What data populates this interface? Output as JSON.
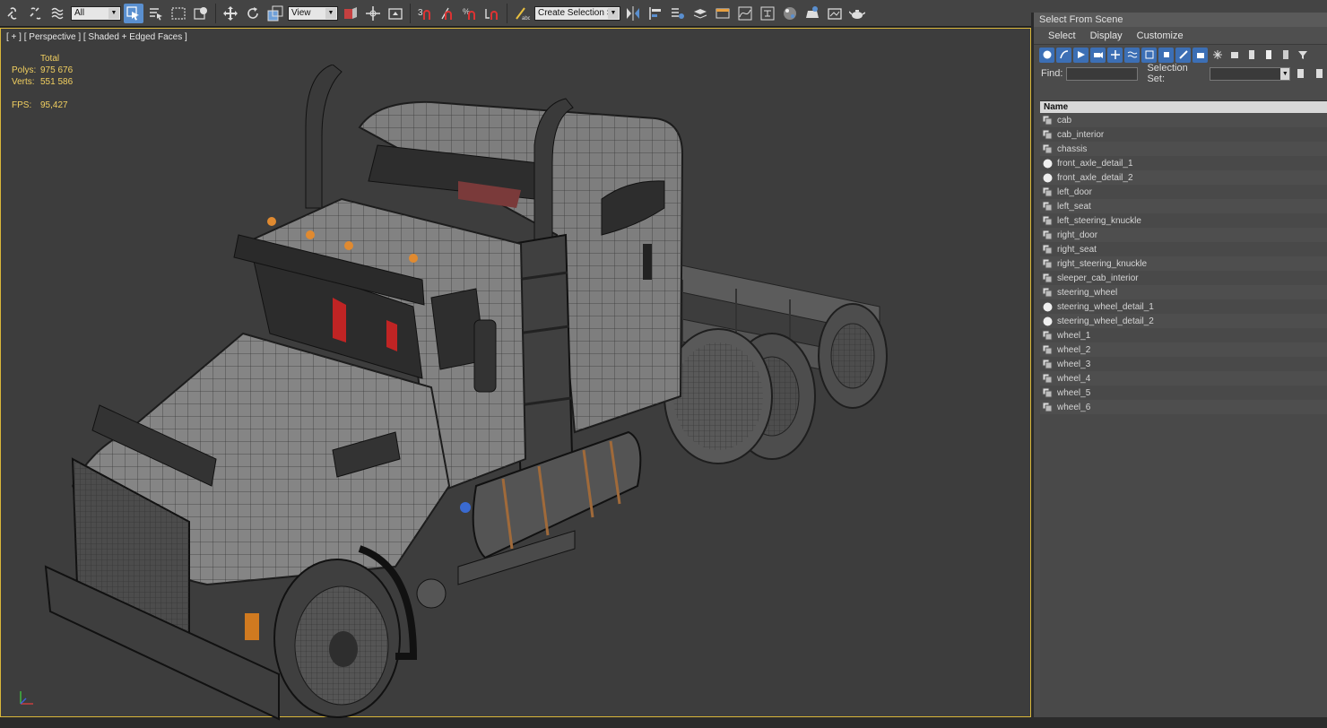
{
  "toolbar": {
    "filter_dropdown": "All",
    "reference_dropdown": "View",
    "selection_set_dropdown": "Create Selection Se"
  },
  "viewport": {
    "label": "[ + ] [ Perspective ] [ Shaded + Edged Faces ]",
    "stats": {
      "total_label": "Total",
      "polys_label": "Polys:",
      "polys_value": "975 676",
      "verts_label": "Verts:",
      "verts_value": "551 586",
      "fps_label": "FPS:",
      "fps_value": "95,427"
    }
  },
  "dialog": {
    "title": "Select From Scene",
    "menu": [
      "Select",
      "Display",
      "Customize"
    ],
    "find_label": "Find:",
    "find_value": "",
    "selection_set_label": "Selection Set:",
    "column_header": "Name",
    "items": [
      {
        "name": "cab",
        "type": "mesh"
      },
      {
        "name": "cab_interior",
        "type": "mesh"
      },
      {
        "name": "chassis",
        "type": "mesh"
      },
      {
        "name": "front_axle_detail_1",
        "type": "sphere"
      },
      {
        "name": "front_axle_detail_2",
        "type": "sphere"
      },
      {
        "name": "left_door",
        "type": "mesh"
      },
      {
        "name": "left_seat",
        "type": "mesh"
      },
      {
        "name": "left_steering_knuckle",
        "type": "mesh"
      },
      {
        "name": "right_door",
        "type": "mesh"
      },
      {
        "name": "right_seat",
        "type": "mesh"
      },
      {
        "name": "right_steering_knuckle",
        "type": "mesh"
      },
      {
        "name": "sleeper_cab_interior",
        "type": "mesh"
      },
      {
        "name": "steering_wheel",
        "type": "mesh"
      },
      {
        "name": "steering_wheel_detail_1",
        "type": "sphere"
      },
      {
        "name": "steering_wheel_detail_2",
        "type": "sphere"
      },
      {
        "name": "wheel_1",
        "type": "mesh"
      },
      {
        "name": "wheel_2",
        "type": "mesh"
      },
      {
        "name": "wheel_3",
        "type": "mesh"
      },
      {
        "name": "wheel_4",
        "type": "mesh"
      },
      {
        "name": "wheel_5",
        "type": "mesh"
      },
      {
        "name": "wheel_6",
        "type": "mesh"
      }
    ]
  },
  "colors": {
    "viewport_bg": "#3d3d3d",
    "viewport_border": "#d9b73a",
    "stats_text": "#f2d060",
    "accent": "#3c6fb5"
  }
}
